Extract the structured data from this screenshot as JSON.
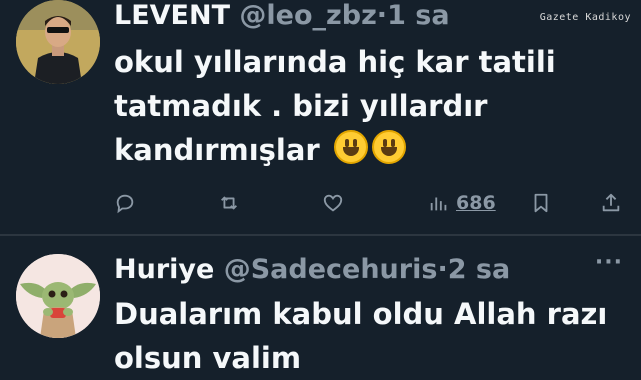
{
  "watermark": "Gazete Kadikoy",
  "tweets": [
    {
      "display_name": "LEVENT",
      "handle": "@leo_zbz",
      "separator": "·",
      "time": "1 sa",
      "text_lines": [
        "okul yıllarında hiç kar tatili",
        "tatmadık . bizi yıllardır",
        "kandırmışlar"
      ],
      "emojis": [
        "grinning-face",
        "grinning-face"
      ],
      "views": "686",
      "icons": [
        "reply-icon",
        "retweet-icon",
        "like-icon",
        "views-icon",
        "bookmark-icon",
        "share-icon"
      ]
    },
    {
      "display_name": "Huriye",
      "handle": "@Sadecehuris",
      "separator": "·",
      "time": "2 sa",
      "more": "···",
      "text_lines": [
        "Dualarım kabul oldu Allah razı",
        "olsun valim"
      ]
    }
  ],
  "colors": {
    "background": "#15202b",
    "text": "#f5f8fa",
    "muted": "#8b98a5",
    "divider": "#2c3640"
  }
}
